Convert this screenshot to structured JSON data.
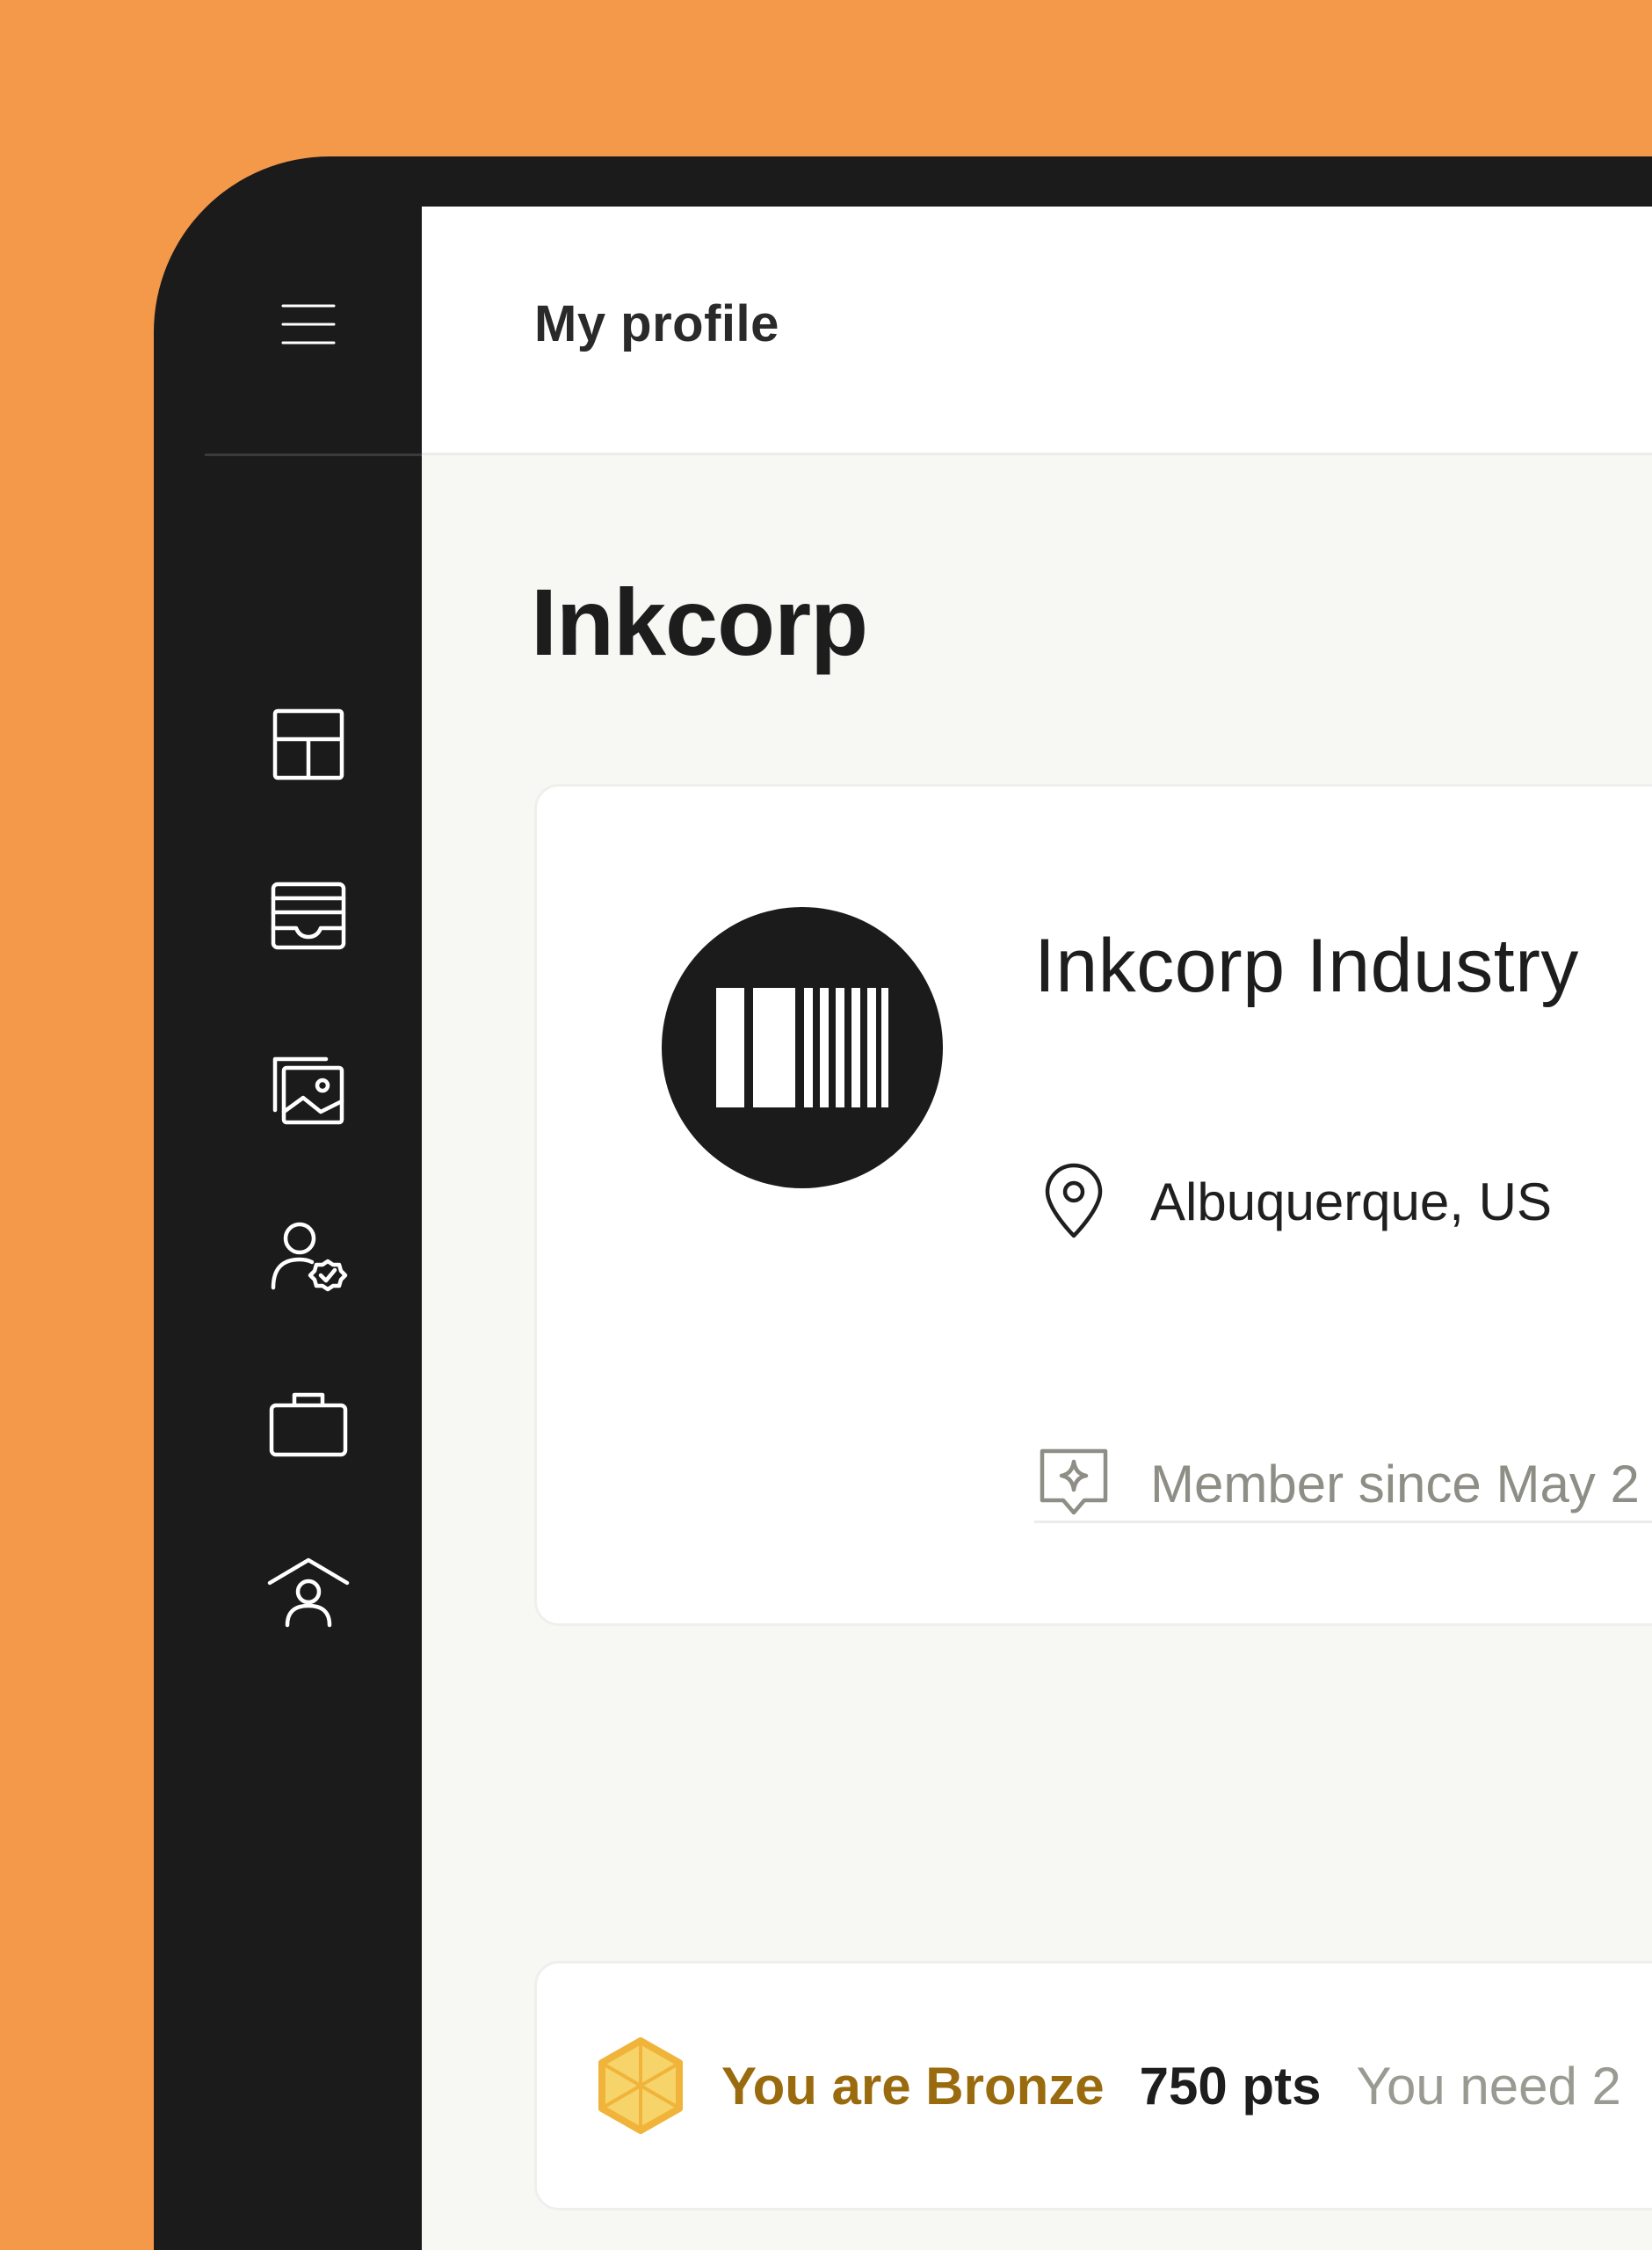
{
  "header": {
    "title": "My profile"
  },
  "company": {
    "heading": "Inkcorp",
    "name": "Inkcorp Industry",
    "location": "Albuquerque, US",
    "member_since": "Member since May 2"
  },
  "rewards": {
    "tier_label": "You are Bronze",
    "points": "750 pts",
    "points_needed": "You need 2"
  },
  "sidebar": {
    "items": [
      {
        "icon": "dashboard-icon"
      },
      {
        "icon": "inbox-icon"
      },
      {
        "icon": "gallery-icon"
      },
      {
        "icon": "verified-user-icon"
      },
      {
        "icon": "briefcase-icon"
      },
      {
        "icon": "home-user-icon"
      }
    ]
  },
  "colors": {
    "background": "#f4984a",
    "sidebar": "#1b1b1b",
    "bronze_text": "#9a6b0e",
    "bronze_badge": "#f2bd3f"
  }
}
